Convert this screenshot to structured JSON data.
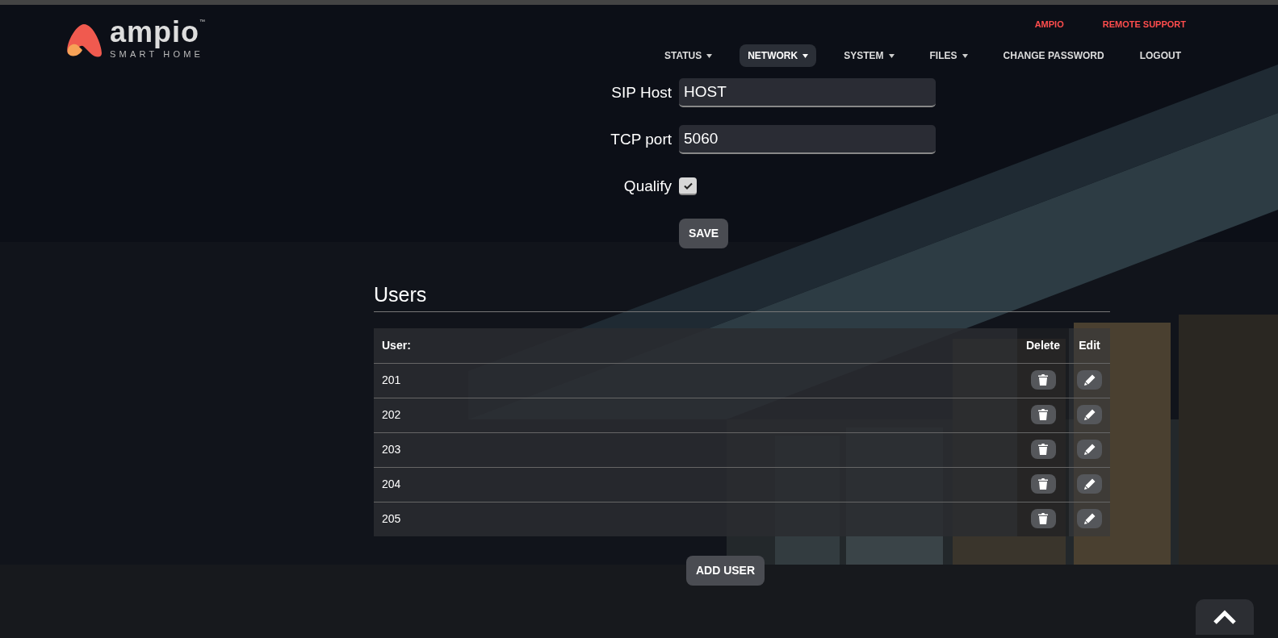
{
  "logo": {
    "name": "ampio",
    "tm": "™",
    "tagline": "SMART HOME"
  },
  "top_links": [
    "AMPIO",
    "REMOTE SUPPORT"
  ],
  "nav": [
    {
      "label": "STATUS",
      "has_menu": true,
      "selected": false
    },
    {
      "label": "NETWORK",
      "has_menu": true,
      "selected": true
    },
    {
      "label": "SYSTEM",
      "has_menu": true,
      "selected": false
    },
    {
      "label": "FILES",
      "has_menu": true,
      "selected": false
    },
    {
      "label": "CHANGE PASSWORD",
      "has_menu": false,
      "selected": false
    },
    {
      "label": "LOGOUT",
      "has_menu": false,
      "selected": false
    }
  ],
  "form": {
    "fields": [
      {
        "kind": "text",
        "label": "SIP Host",
        "value": "HOST"
      },
      {
        "kind": "text",
        "label": "TCP port",
        "value": "5060"
      },
      {
        "kind": "checkbox",
        "label": "Qualify",
        "checked": true
      }
    ],
    "save_button": "SAVE"
  },
  "users": {
    "title": "Users",
    "columns": [
      "User:",
      "Delete",
      "Edit"
    ],
    "rows": [
      {
        "user": "201"
      },
      {
        "user": "202"
      },
      {
        "user": "203"
      },
      {
        "user": "204"
      },
      {
        "user": "205"
      }
    ],
    "add_button": "ADD USER"
  }
}
